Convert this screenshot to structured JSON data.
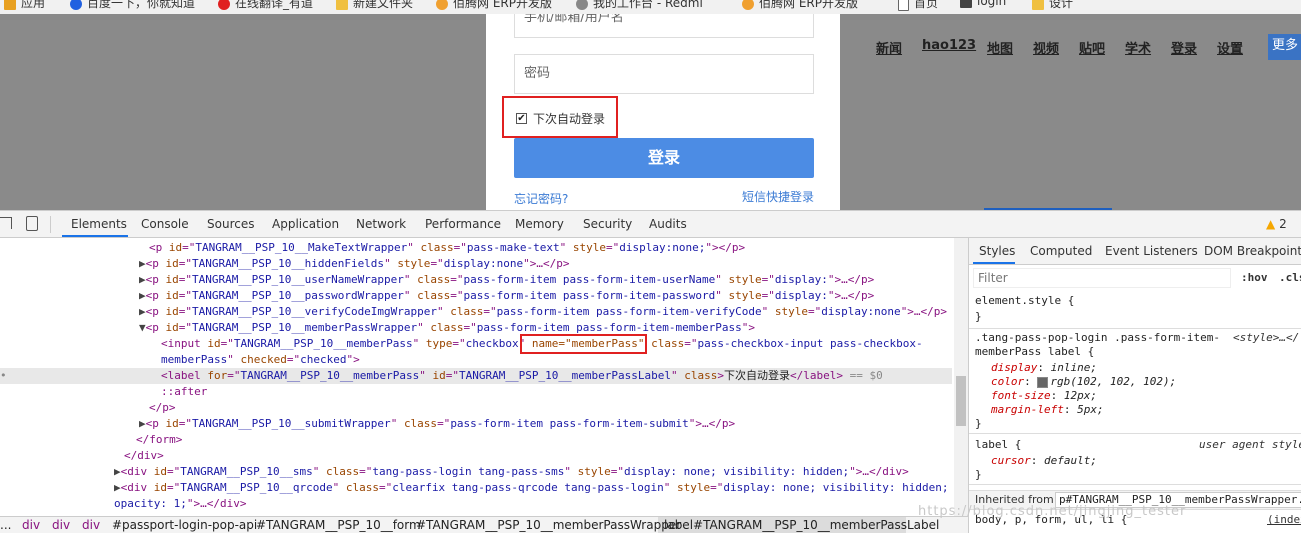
{
  "bookmarks": [
    {
      "label": "应用",
      "color": "#e8a020"
    },
    {
      "label": "百度一下，你就知道",
      "color": "#2060e0"
    },
    {
      "label": "在线翻译_有道",
      "color": "#e02020"
    },
    {
      "label": "新建文件夹",
      "color": "#f0c040"
    },
    {
      "label": "佰腾网 ERP开发版",
      "color": "#f0a030"
    },
    {
      "label": "我的工作台 - Redmi",
      "color": "#888888"
    },
    {
      "label": "佰腾网 ERP开发版",
      "color": "#f0a030"
    },
    {
      "label": "首页",
      "color": "#666666"
    },
    {
      "label": "login",
      "color": "#444444"
    },
    {
      "label": "设计",
      "color": "#f0c040"
    }
  ],
  "page": {
    "nav": [
      "新闻",
      "hao123",
      "地图",
      "视频",
      "贴吧",
      "学术",
      "登录",
      "设置"
    ],
    "more": "更多",
    "login": {
      "username_placeholder": "手机/邮箱/用户名",
      "password_placeholder": "密码",
      "remember_label": "下次自动登录",
      "remember_checked": true,
      "submit": "登录",
      "forgot": "忘记密码?",
      "sms": "短信快捷登录"
    }
  },
  "devtools": {
    "tabs": [
      "Elements",
      "Console",
      "Sources",
      "Application",
      "Network",
      "Performance",
      "Memory",
      "Security",
      "Audits"
    ],
    "active_tab": "Elements",
    "warnings": "2",
    "breadcrumbs": [
      "div",
      "div",
      "div",
      "#passport-login-pop-api",
      "#TANGRAM__PSP_10__form",
      "#TANGRAM__PSP_10__memberPassWrapper",
      "label#TANGRAM__PSP_10__memberPassLabel"
    ],
    "crumb_prefix": "..."
  },
  "dom": {
    "l1": {
      "id": "TANGRAM__PSP_10__MakeTextWrapper",
      "cls": "pass-make-text",
      "style": "display:none;"
    },
    "l2": {
      "id": "TANGRAM__PSP_10__hiddenFields",
      "style": "display:none"
    },
    "l3": {
      "id": "TANGRAM__PSP_10__userNameWrapper",
      "cls": "pass-form-item pass-form-item-userName",
      "style": "display:"
    },
    "l4": {
      "id": "TANGRAM__PSP_10__passwordWrapper",
      "cls": "pass-form-item pass-form-item-password",
      "style": "display:"
    },
    "l5": {
      "id": "TANGRAM__PSP_10__verifyCodeImgWrapper",
      "cls": "pass-form-item pass-form-item-verifyCode",
      "style": "display:none"
    },
    "l6": {
      "id": "TANGRAM__PSP_10__memberPassWrapper",
      "cls": "pass-form-item pass-form-item-memberPass"
    },
    "input": {
      "id": "TANGRAM__PSP_10__memberPass",
      "type": "checkbox",
      "name": "name=\"memberPass\"",
      "cls": "pass-checkbox-input pass-checkbox-",
      "cls2": "memberPass",
      "checked": "checked"
    },
    "label": {
      "for": "TANGRAM__PSP_10__memberPass",
      "id": "TANGRAM__PSP_10__memberPassLabel",
      "cls": "",
      "text": "下次自动登录",
      "marker": "== $0"
    },
    "after": "::after",
    "submit": {
      "id": "TANGRAM__PSP_10__submitWrapper",
      "cls": "pass-form-item pass-form-item-submit"
    },
    "sms": {
      "id": "TANGRAM__PSP_10__sms",
      "cls": "tang-pass-login tang-pass-sms",
      "style": "display: none; visibility: hidden;"
    },
    "qrcode": {
      "id": "TANGRAM__PSP_10__qrcode",
      "cls": "clearfix tang-pass-qrcode tang-pass-login",
      "style": "display: none; visibility: hidden;",
      "style2": "opacity: 1;"
    }
  },
  "styles": {
    "tabs": [
      "Styles",
      "Computed",
      "Event Listeners",
      "DOM Breakpoints"
    ],
    "filter_placeholder": "Filter",
    "hov": ":hov",
    "cls": ".cls",
    "element_style": "element.style {",
    "rule1_selector": ".tang-pass-pop-login .pass-form-item-",
    "rule1_selector2": "memberPass label {",
    "rule1_source": "<style>…</",
    "rule1_props": [
      {
        "name": "display",
        "value": "inline;"
      },
      {
        "name": "color",
        "value": "rgb(102, 102, 102);",
        "swatch": "#666666"
      },
      {
        "name": "font-size",
        "value": "12px;"
      },
      {
        "name": "margin-left",
        "value": "5px;"
      }
    ],
    "rule2_selector": "label {",
    "rule2_source": "user agent style",
    "rule2_props": [
      {
        "name": "cursor",
        "value": "default;"
      }
    ],
    "inherited_label": "Inherited from",
    "inherited_sel": "p#TANGRAM__PSP_10__memberPassWrapper.",
    "body_rule": "body, p, form, ul, li {",
    "body_src": "(index"
  },
  "watermark": "https://blog.csdn.net/jingjing_tester"
}
